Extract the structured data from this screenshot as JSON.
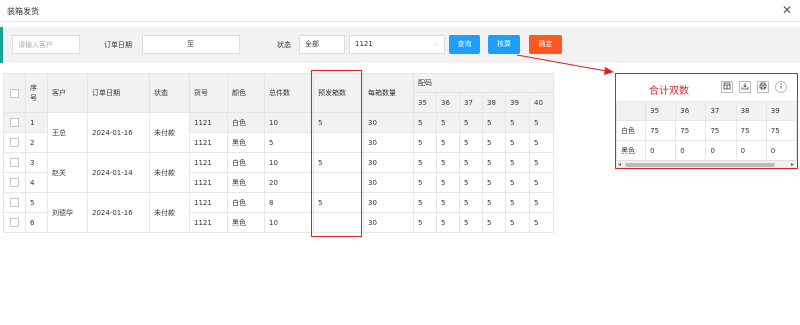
{
  "dialog": {
    "title": "装箱发货",
    "close_glyph": "✕"
  },
  "filters": {
    "customer_placeholder": "请输入客户",
    "order_date_label": "订单日期",
    "date_separator": "至",
    "date_start": "",
    "date_end": "",
    "status_label": "状态",
    "status_value": "全部",
    "code_value": "1121",
    "query_label": "查询",
    "calc_label": "核算",
    "confirm_label": "确定"
  },
  "table": {
    "headers": {
      "seq": "序号",
      "customer": "客户",
      "order_date": "订单日期",
      "status": "状态",
      "code": "货号",
      "color": "颜色",
      "total": "总件数",
      "preset_boxes": "预发箱数",
      "per_box": "每箱数量",
      "size_group": "配码"
    },
    "sizes": [
      "35",
      "36",
      "37",
      "38",
      "39",
      "40"
    ],
    "orders": [
      {
        "customer": "王总",
        "date": "2024-01-16",
        "status": "未付款",
        "rows": [
          {
            "seq": "1",
            "code": "1121",
            "color": "白色",
            "total": "10",
            "preset": "5",
            "per_box": "30",
            "sizes": [
              "5",
              "5",
              "5",
              "5",
              "5",
              "5"
            ]
          },
          {
            "seq": "2",
            "code": "1121",
            "color": "黑色",
            "total": "5",
            "preset": "",
            "per_box": "30",
            "sizes": [
              "5",
              "5",
              "5",
              "5",
              "5",
              "5"
            ]
          }
        ]
      },
      {
        "customer": "赵关",
        "date": "2024-01-14",
        "status": "未付款",
        "rows": [
          {
            "seq": "3",
            "code": "1121",
            "color": "白色",
            "total": "10",
            "preset": "5",
            "per_box": "30",
            "sizes": [
              "5",
              "5",
              "5",
              "5",
              "5",
              "5"
            ]
          },
          {
            "seq": "4",
            "code": "1121",
            "color": "黑色",
            "total": "20",
            "preset": "",
            "per_box": "30",
            "sizes": [
              "5",
              "5",
              "5",
              "5",
              "5",
              "5"
            ]
          }
        ]
      },
      {
        "customer": "刘德华",
        "date": "2024-01-16",
        "status": "未付款",
        "rows": [
          {
            "seq": "5",
            "code": "1121",
            "color": "白色",
            "total": "8",
            "preset": "5",
            "per_box": "30",
            "sizes": [
              "5",
              "5",
              "5",
              "5",
              "5",
              "5"
            ]
          },
          {
            "seq": "6",
            "code": "1121",
            "color": "黑色",
            "total": "10",
            "preset": "",
            "per_box": "30",
            "sizes": [
              "5",
              "5",
              "5",
              "5",
              "5",
              "5"
            ]
          }
        ]
      }
    ]
  },
  "summary": {
    "title": "合计双数",
    "tool_icons": [
      "filter-columns-icon",
      "export-icon",
      "print-icon",
      "info-icon"
    ],
    "sizes": [
      "35",
      "36",
      "37",
      "38",
      "39"
    ],
    "rows": [
      {
        "color": "白色",
        "values": [
          "75",
          "75",
          "75",
          "75",
          "75"
        ]
      },
      {
        "color": "黑色",
        "values": [
          "0",
          "0",
          "0",
          "0",
          "0"
        ]
      }
    ],
    "scroll_left": "◂",
    "scroll_right": "▸"
  },
  "colors": {
    "accent_teal": "#1aa394",
    "button_blue": "#1e9fff",
    "button_orange": "#ff5722",
    "highlight_red": "#e02020"
  }
}
